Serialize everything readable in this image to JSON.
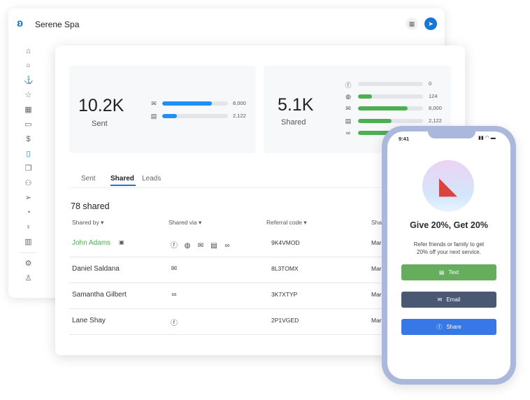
{
  "app": {
    "title": "Serene Spa",
    "apps_icon": "grid-icon",
    "send_icon": "paper-plane-icon",
    "accent": "#1976d2"
  },
  "sidebar": [
    "home-icon",
    "chat-icon",
    "anchor-icon",
    "star-icon",
    "grid-table-icon",
    "calendar-icon",
    "dollar-icon",
    "document-icon",
    "copy-icon",
    "users-icon",
    "send-icon",
    "pie-chart-icon",
    "lightbulb-icon",
    "bar-chart-icon",
    "settings-icon",
    "user-icon"
  ],
  "sent": {
    "value": "10.2K",
    "label": "Sent",
    "rows": [
      {
        "icon": "email-icon",
        "value": "8,000",
        "fill": 0.76
      },
      {
        "icon": "text-message-icon",
        "value": "2,122",
        "fill": 0.22
      }
    ],
    "color": "#1e90f5"
  },
  "shared": {
    "value": "5.1K",
    "label": "Shared",
    "rows": [
      {
        "icon": "facebook-icon",
        "value": "0",
        "fill": 0
      },
      {
        "icon": "messenger-icon",
        "value": "124",
        "fill": 0.22
      },
      {
        "icon": "email-icon",
        "value": "8,000",
        "fill": 0.76
      },
      {
        "icon": "text-message-icon",
        "value": "2,122",
        "fill": 0.52
      },
      {
        "icon": "link-icon",
        "value": "",
        "fill": 0.5
      }
    ],
    "color": "#4caf50"
  },
  "tabs": [
    "Sent",
    "Shared",
    "Leads"
  ],
  "active_tab": "Shared",
  "count": "78 shared",
  "table": {
    "headers": [
      "Shared by",
      "Shared via",
      "Referral code",
      "Sha"
    ],
    "rows": [
      {
        "name": "John Adams",
        "highlight": true,
        "via": [
          "facebook-icon",
          "messenger-icon",
          "email-icon",
          "text-message-icon",
          "link-icon"
        ],
        "code": "9K4VMOD",
        "date": "Mar"
      },
      {
        "name": "Daniel Saldana",
        "via": [
          "email-icon"
        ],
        "code": "8L3TOMX",
        "date": "Mar"
      },
      {
        "name": "Samantha Gilbert",
        "via": [
          "link-icon"
        ],
        "code": "3K7XTYP",
        "date": "Mar"
      },
      {
        "name": "Lane Shay",
        "via": [
          "facebook-icon"
        ],
        "code": "2P1VGED",
        "date": "Mar"
      }
    ]
  },
  "phone": {
    "time": "9:41",
    "title": "Give 20%, Get 20%",
    "subtitle_1": "Refer friends or family to get",
    "subtitle_2": "20% off your next service.",
    "buttons": [
      {
        "label": "Text",
        "icon": "text-message-icon",
        "color": "#66ad5e"
      },
      {
        "label": "Email",
        "icon": "email-icon",
        "color": "#4a5874"
      },
      {
        "label": "Share",
        "icon": "facebook-icon",
        "color": "#3878e6"
      }
    ]
  }
}
